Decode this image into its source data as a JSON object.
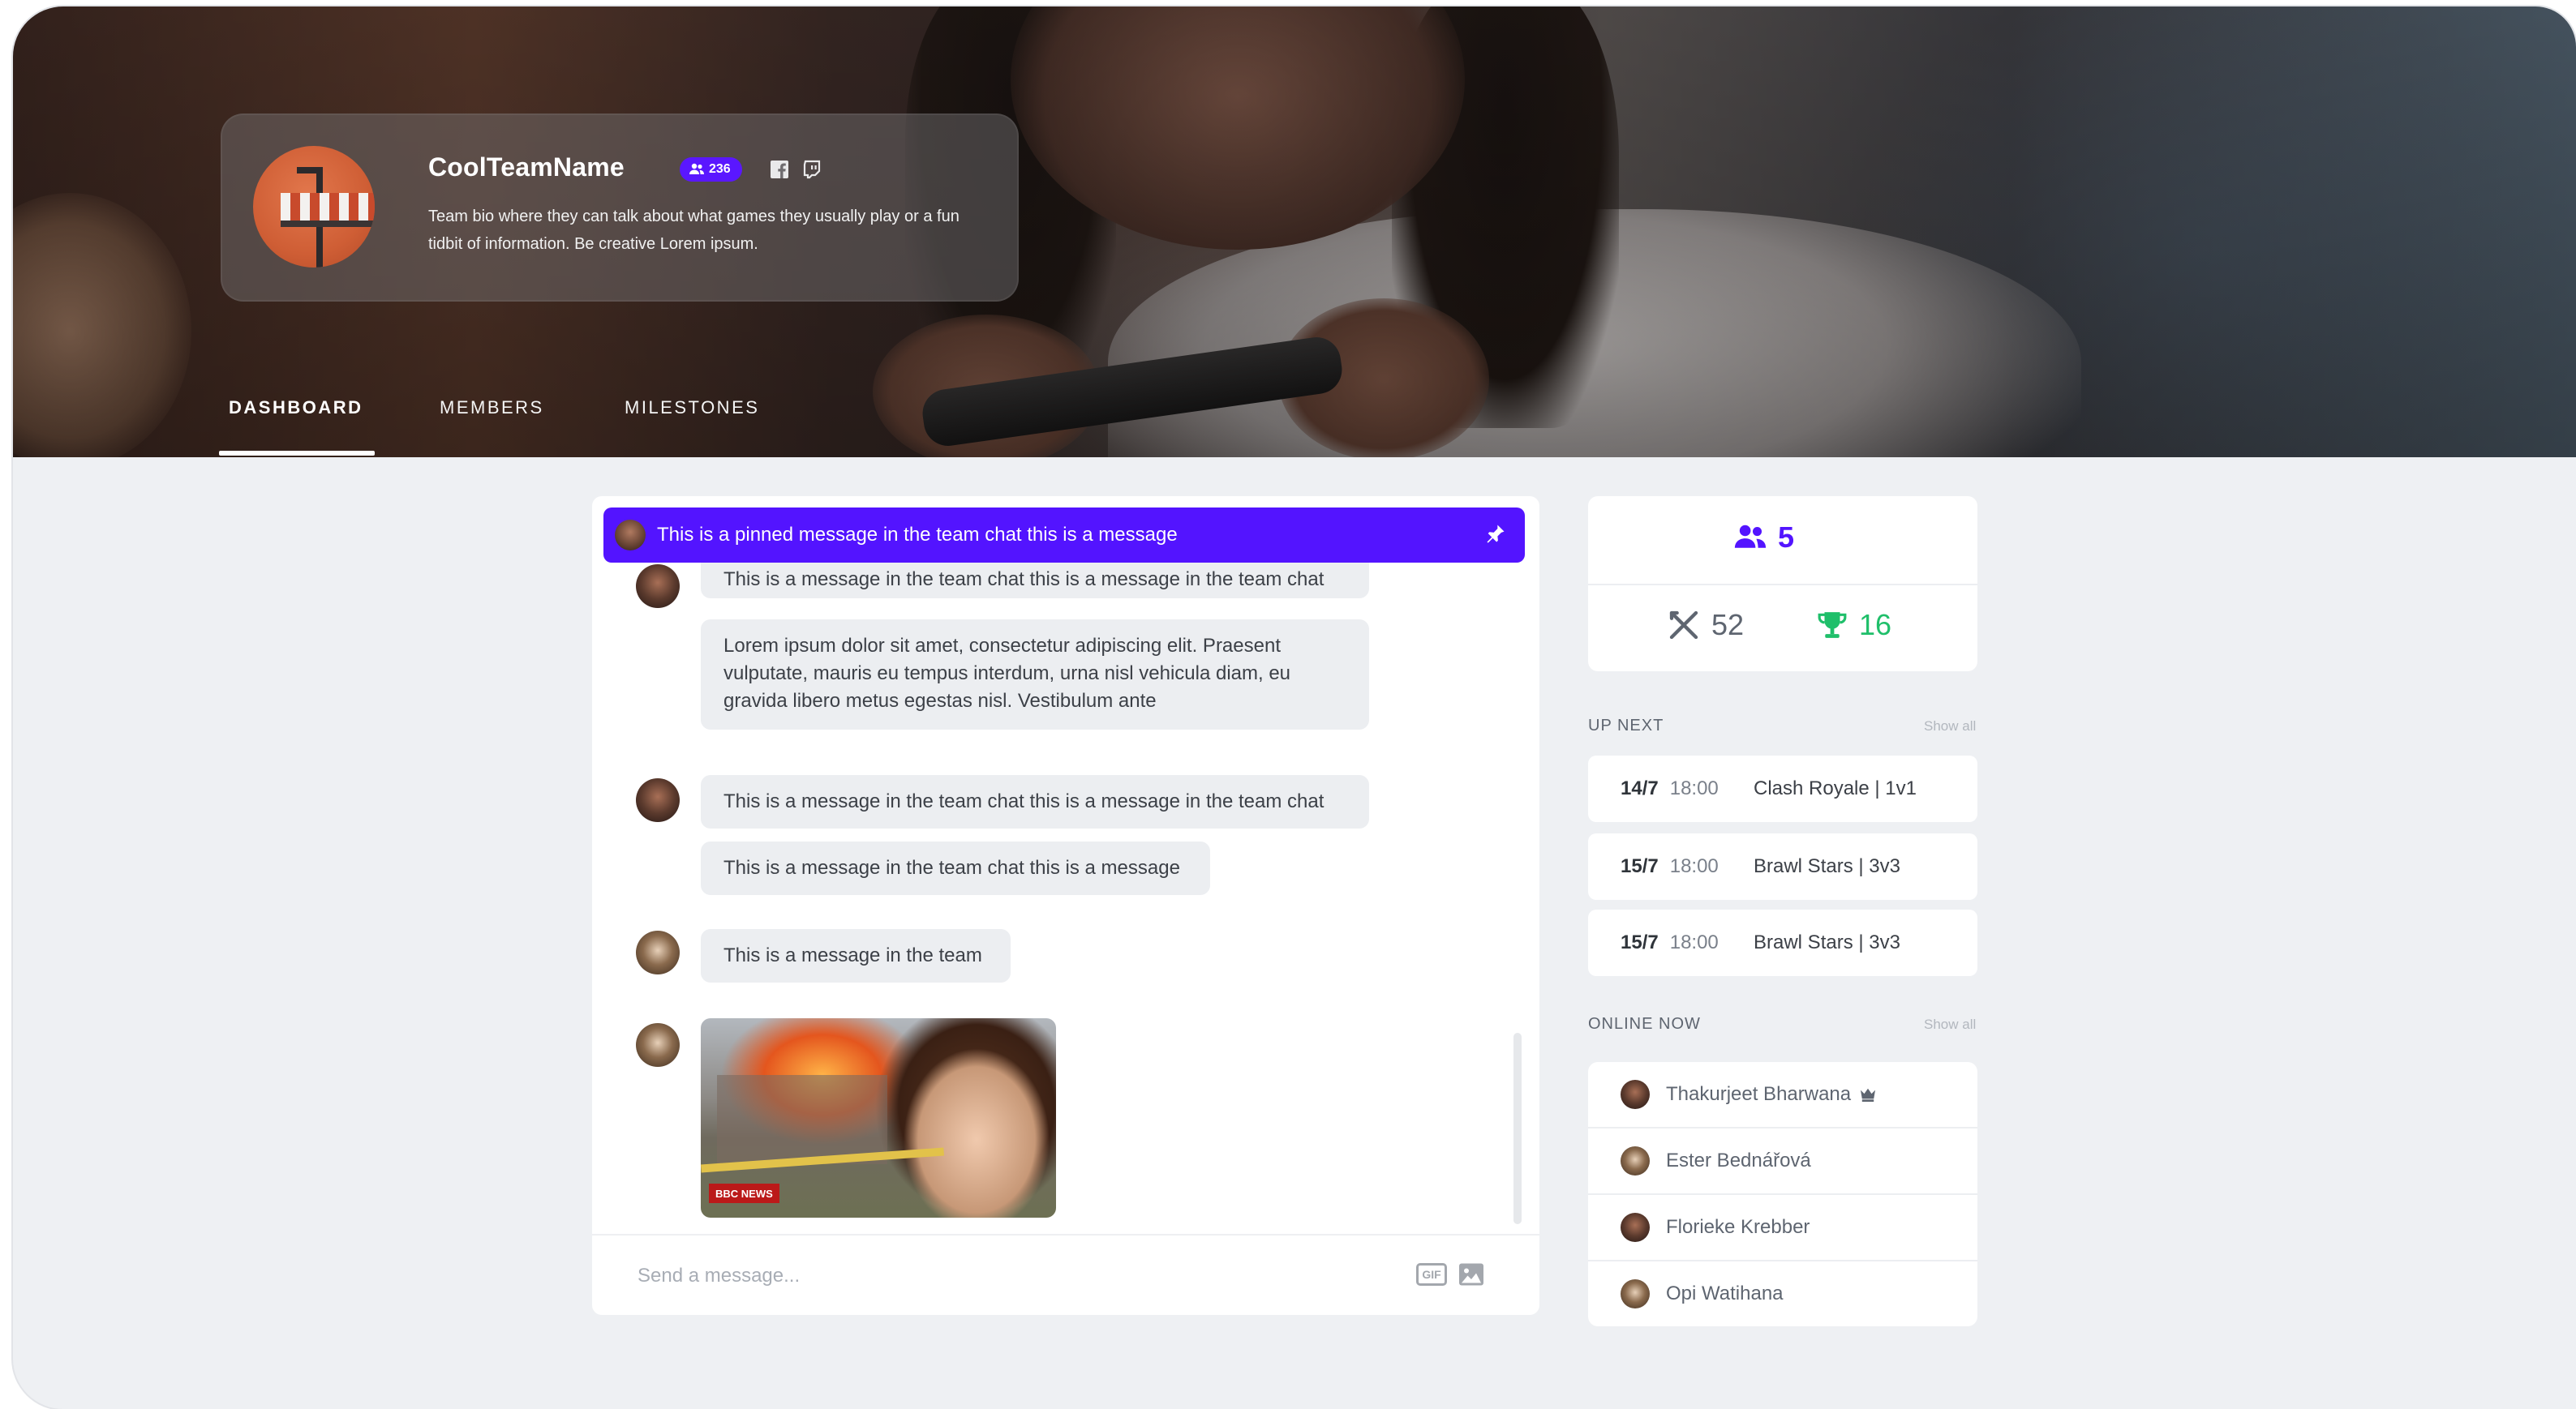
{
  "team": {
    "name": "CoolTeamName",
    "member_count": "236",
    "bio": "Team bio where they can talk about what games they usually play or a fun tidbit of information. Be creative Lorem ipsum."
  },
  "tabs": [
    {
      "label": "DASHBOARD",
      "active": true
    },
    {
      "label": "MEMBERS",
      "active": false
    },
    {
      "label": "MILESTONES",
      "active": false
    }
  ],
  "chat": {
    "pinned": "This is a pinned message in the team chat this is a message",
    "messages": [
      {
        "text": "This is a message in the team chat this is a message in the team chat"
      },
      {
        "text": "Lorem ipsum dolor sit amet, consectetur adipiscing elit. Praesent vulputate, mauris eu tempus interdum, urna nisl vehicula diam, eu gravida libero metus egestas nisl. Vestibulum ante"
      },
      {
        "text": "This is a message in the team chat this is a message in the team chat"
      },
      {
        "text": "This is a message in the team chat this is a message"
      },
      {
        "text": "This is a message in the team"
      }
    ],
    "image_badge": "BBC NEWS",
    "composer_placeholder": "Send a message...",
    "gif_label": "GIF"
  },
  "stats": {
    "members": "5",
    "matches": "52",
    "wins": "16",
    "accent": "#5314ff",
    "win_color": "#1fbf6a"
  },
  "up_next": {
    "label": "UP NEXT",
    "show_all": "Show all",
    "matches": [
      {
        "date": "14/7",
        "time": "18:00",
        "game": "Clash Royale | 1v1"
      },
      {
        "date": "15/7",
        "time": "18:00",
        "game": "Brawl Stars | 3v3"
      },
      {
        "date": "15/7",
        "time": "18:00",
        "game": "Brawl Stars | 3v3"
      }
    ]
  },
  "online_now": {
    "label": "ONLINE NOW",
    "show_all": "Show all",
    "users": [
      {
        "name": "Thakurjeet Bharwana",
        "icon": "crown-icon"
      },
      {
        "name": "Ester Bednářová"
      },
      {
        "name": "Florieke Krebber"
      },
      {
        "name": "Opi Watihana"
      }
    ]
  }
}
